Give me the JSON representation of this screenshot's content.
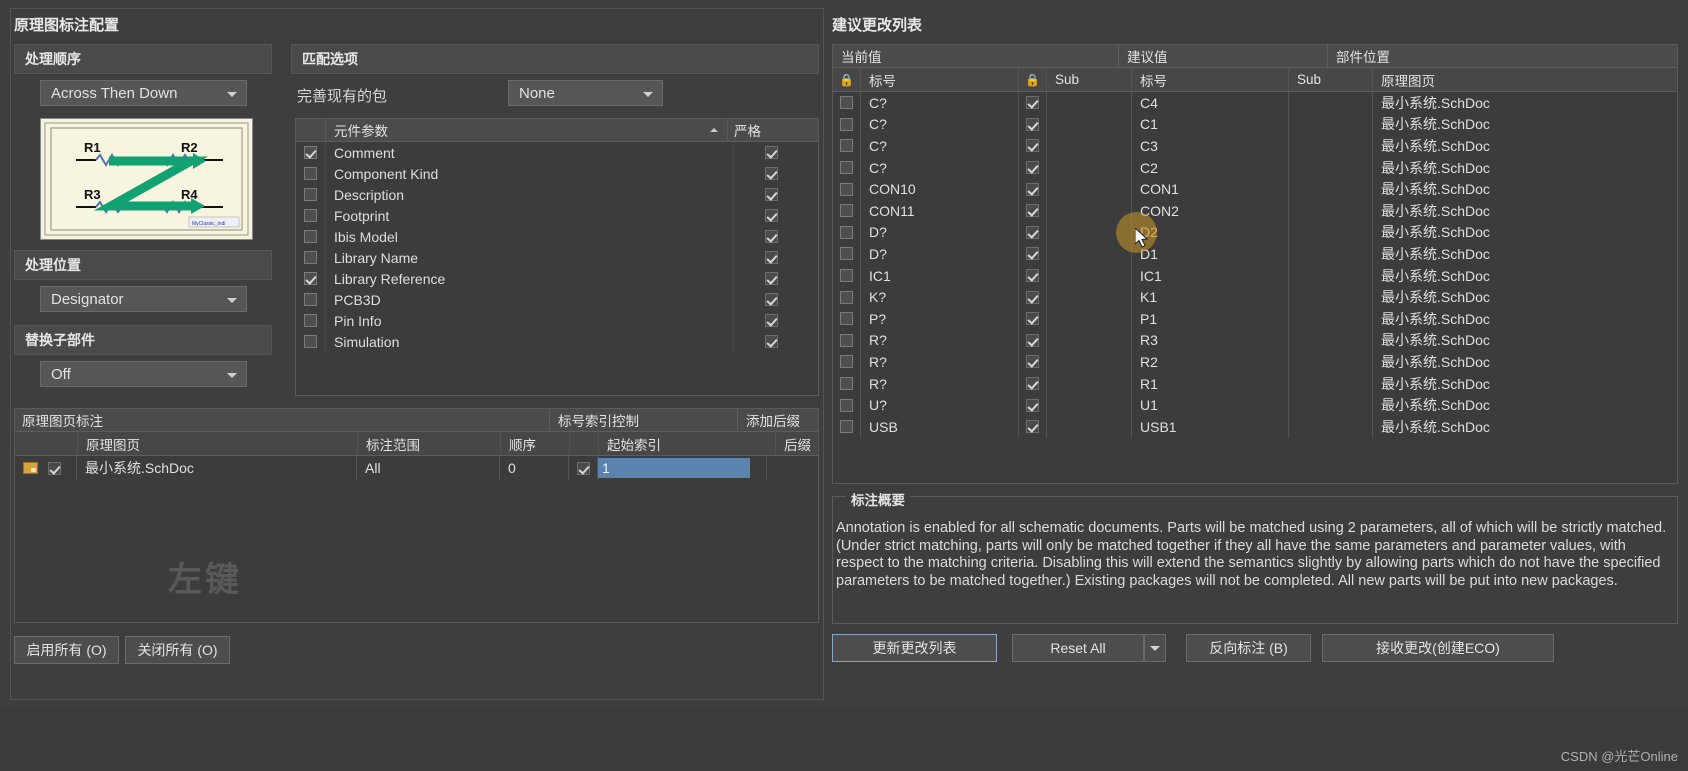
{
  "left": {
    "title": "原理图标注配置",
    "process_order": {
      "header": "处理顺序",
      "value": "Across Then Down",
      "thumb": {
        "r1": "R1",
        "r2": "R2",
        "r3": "R3",
        "r4": "R4",
        "stamp": "MyClassic_indi"
      }
    },
    "process_position": {
      "header": "处理位置",
      "value": "Designator"
    },
    "replace_sub": {
      "header": "替换子部件",
      "value": "Off"
    },
    "match": {
      "header": "匹配选项",
      "label": "完善现有的包",
      "value": "None",
      "col_param": "元件参数",
      "col_strict": "严格",
      "rows": [
        {
          "name": "Comment",
          "checked": true,
          "strict": true
        },
        {
          "name": "Component Kind",
          "checked": false,
          "strict": true
        },
        {
          "name": "Description",
          "checked": false,
          "strict": true
        },
        {
          "name": "Footprint",
          "checked": false,
          "strict": true
        },
        {
          "name": "Ibis Model",
          "checked": false,
          "strict": true
        },
        {
          "name": "Library Name",
          "checked": false,
          "strict": true
        },
        {
          "name": "Library Reference",
          "checked": true,
          "strict": true
        },
        {
          "name": "PCB3D",
          "checked": false,
          "strict": true
        },
        {
          "name": "Pin Info",
          "checked": false,
          "strict": true
        },
        {
          "name": "Simulation",
          "checked": false,
          "strict": true
        }
      ]
    },
    "sheet_table": {
      "group_sheet": "原理图页标注",
      "group_index": "标号索引控制",
      "group_suffix": "添加后缀",
      "col_sheet": "原理图页",
      "col_scope": "标注范围",
      "col_order": "顺序",
      "col_start": "起始索引",
      "col_suffix": "后缀",
      "rows": [
        {
          "enabled": true,
          "sheet": "最小系统.SchDoc",
          "scope": "All",
          "order": "0",
          "start_on": true,
          "start": "1",
          "suffix": ""
        }
      ]
    },
    "overlay_text": "左键",
    "enable_all": "启用所有 (O)",
    "disable_all": "关闭所有 (O)"
  },
  "right": {
    "title": "建议更改列表",
    "table": {
      "group_current": "当前值",
      "group_proposed": "建议值",
      "group_location": "部件位置",
      "col_lock": "lock-icon",
      "col_designator": "标号",
      "col_sub": "Sub",
      "col_prop_designator": "标号",
      "col_prop_sub": "Sub",
      "col_sheet": "原理图页",
      "rows": [
        {
          "sel": false,
          "cur": "C?",
          "sub_lock": true,
          "cur_sub": "",
          "prop": "C4",
          "prop_sub": "",
          "sheet": "最小系统.SchDoc",
          "hover": false
        },
        {
          "sel": false,
          "cur": "C?",
          "sub_lock": true,
          "cur_sub": "",
          "prop": "C1",
          "prop_sub": "",
          "sheet": "最小系统.SchDoc",
          "hover": false
        },
        {
          "sel": false,
          "cur": "C?",
          "sub_lock": true,
          "cur_sub": "",
          "prop": "C3",
          "prop_sub": "",
          "sheet": "最小系统.SchDoc",
          "hover": false
        },
        {
          "sel": false,
          "cur": "C?",
          "sub_lock": true,
          "cur_sub": "",
          "prop": "C2",
          "prop_sub": "",
          "sheet": "最小系统.SchDoc",
          "hover": false
        },
        {
          "sel": false,
          "cur": "CON10",
          "sub_lock": true,
          "cur_sub": "",
          "prop": "CON1",
          "prop_sub": "",
          "sheet": "最小系统.SchDoc",
          "hover": false
        },
        {
          "sel": false,
          "cur": "CON11",
          "sub_lock": true,
          "cur_sub": "",
          "prop": "CON2",
          "prop_sub": "",
          "sheet": "最小系统.SchDoc",
          "hover": false
        },
        {
          "sel": false,
          "cur": "D?",
          "sub_lock": true,
          "cur_sub": "",
          "prop": "D2",
          "prop_sub": "",
          "sheet": "最小系统.SchDoc",
          "hover": true
        },
        {
          "sel": false,
          "cur": "D?",
          "sub_lock": true,
          "cur_sub": "",
          "prop": "D1",
          "prop_sub": "",
          "sheet": "最小系统.SchDoc",
          "hover": false
        },
        {
          "sel": false,
          "cur": "IC1",
          "sub_lock": true,
          "cur_sub": "",
          "prop": "IC1",
          "prop_sub": "",
          "sheet": "最小系统.SchDoc",
          "hover": false
        },
        {
          "sel": false,
          "cur": "K?",
          "sub_lock": true,
          "cur_sub": "",
          "prop": "K1",
          "prop_sub": "",
          "sheet": "最小系统.SchDoc",
          "hover": false
        },
        {
          "sel": false,
          "cur": "P?",
          "sub_lock": true,
          "cur_sub": "",
          "prop": "P1",
          "prop_sub": "",
          "sheet": "最小系统.SchDoc",
          "hover": false
        },
        {
          "sel": false,
          "cur": "R?",
          "sub_lock": true,
          "cur_sub": "",
          "prop": "R3",
          "prop_sub": "",
          "sheet": "最小系统.SchDoc",
          "hover": false
        },
        {
          "sel": false,
          "cur": "R?",
          "sub_lock": true,
          "cur_sub": "",
          "prop": "R2",
          "prop_sub": "",
          "sheet": "最小系统.SchDoc",
          "hover": false
        },
        {
          "sel": false,
          "cur": "R?",
          "sub_lock": true,
          "cur_sub": "",
          "prop": "R1",
          "prop_sub": "",
          "sheet": "最小系统.SchDoc",
          "hover": false
        },
        {
          "sel": false,
          "cur": "U?",
          "sub_lock": true,
          "cur_sub": "",
          "prop": "U1",
          "prop_sub": "",
          "sheet": "最小系统.SchDoc",
          "hover": false
        },
        {
          "sel": false,
          "cur": "USB",
          "sub_lock": true,
          "cur_sub": "",
          "prop": "USB1",
          "prop_sub": "",
          "sheet": "最小系统.SchDoc",
          "hover": false
        }
      ]
    },
    "summary": {
      "legend": "标注概要",
      "text": "Annotation is enabled for all schematic documents. Parts will be matched using 2 parameters, all of which will be strictly matched. (Under strict matching, parts will only be matched together if they all have the same parameters and parameter values, with respect to the matching criteria. Disabling this will extend the semantics slightly by allowing parts which do not have the specified parameters to be matched together.) Existing packages will not be completed. All new parts will be put into new packages."
    },
    "buttons": {
      "update": "更新更改列表",
      "reset": "Reset All",
      "back_annotate": "反向标注 (B)",
      "accept": "接收更改(创建ECO)"
    }
  },
  "watermark": "CSDN @光芒Online",
  "colors": {
    "bg": "#3e3e3e",
    "panel": "#3c3c3c",
    "header": "#4b4b4b",
    "text": "#dedede",
    "accent_blue": "#5a84ad",
    "hover": "#c8962899",
    "thumb_bg": "#f5f2de",
    "thumb_green": "#12a06a"
  }
}
